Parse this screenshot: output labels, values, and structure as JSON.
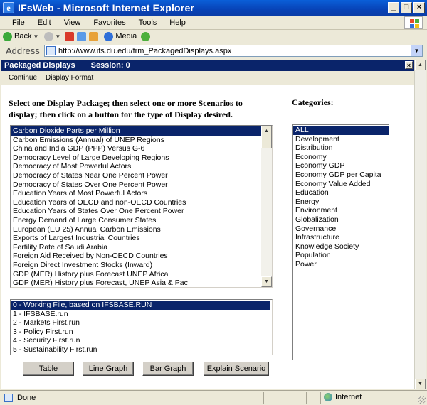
{
  "window": {
    "title": "IFsWeb - Microsoft Internet Explorer",
    "app_icon_letter": "e"
  },
  "window_buttons": {
    "minimize": "_",
    "maximize": "□",
    "close": "×"
  },
  "menubar": {
    "items": [
      "File",
      "Edit",
      "View",
      "Favorites",
      "Tools",
      "Help"
    ]
  },
  "toolbar": {
    "back_label": "Back",
    "media_label": "Media"
  },
  "address": {
    "label": "Address",
    "url": "http://www.ifs.du.edu/frm_PackagedDisplays.aspx"
  },
  "panel": {
    "title": "Packaged Displays",
    "session": "Session: 0",
    "close_label": "×",
    "subtoolbar": [
      "Continue",
      "Display Format"
    ]
  },
  "instructions": "Select one Display Package; then select one or more Scenarios to display; then click on a button for the type of Display desired.",
  "categories_title": "Categories:",
  "packages": [
    "Carbon Dioxide Parts per Million",
    "Carbon Emissions (Annual) of UNEP Regions",
    "China and India GDP (PPP) Versus G-6",
    "Democracy Level of Large Developing Regions",
    "Democracy of Most Powerful Actors",
    "Democracy of States Near One Percent Power",
    "Democracy of States Over One Percent Power",
    "Education Years of Most Powerful Actors",
    "Education Years of OECD and non-OECD Countries",
    "Education Years of States Over One Percent Power",
    "Energy Demand of Large Consumer States",
    "European (EU 25) Annual Carbon Emissions",
    "Exports of Largest Industrial Countries",
    "Fertility Rate of Saudi Arabia",
    "Foreign Aid Received by Non-OECD Countries",
    "Foreign Direct Investment Stocks (Inward)",
    "GDP (MER) History plus Forecast UNEP Africa",
    "GDP (MER) History plus Forecast, UNEP Asia & Pac"
  ],
  "packages_selected": "Carbon Dioxide Parts per Million",
  "scenarios": [
    "0 - Working File, based on IFSBASE.RUN",
    "1 - IFSBASE.run",
    "2 - Markets First.run",
    "3 - Policy First.run",
    "4 - Security First.run",
    "5 - Sustainability First.run"
  ],
  "scenarios_selected": "0 - Working File, based on IFSBASE.RUN",
  "categories": [
    "ALL",
    "Development",
    "Distribution",
    "Economy",
    "Economy GDP",
    "Economy GDP per Capita",
    "Economy Value Added",
    "Education",
    "Energy",
    "Environment",
    "Globalization",
    "Governance",
    "Infrastructure",
    "Knowledge Society",
    "Population",
    "Power"
  ],
  "categories_selected": "ALL",
  "buttons": {
    "table": "Table",
    "line_graph": "Line Graph",
    "bar_graph": "Bar Graph",
    "explain_scenario": "Explain Scenario"
  },
  "status": {
    "text": "Done",
    "zone": "Internet"
  },
  "colors": {
    "titlebar": "#0a5fd8",
    "selection": "#0a246a",
    "chrome": "#ece9d8"
  }
}
